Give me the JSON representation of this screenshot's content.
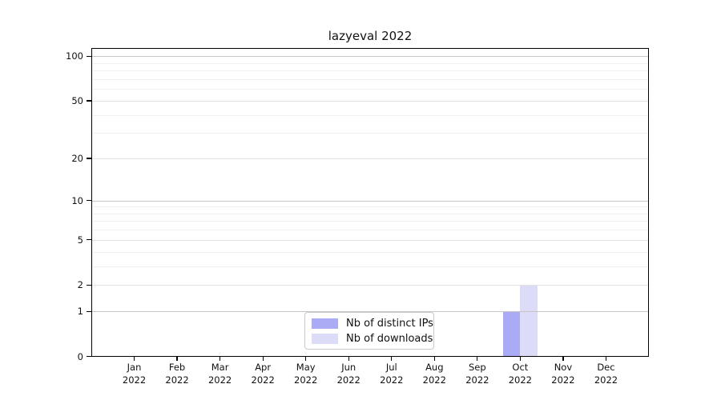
{
  "chart_data": {
    "type": "bar",
    "title": "lazyeval 2022",
    "categories": [
      "Jan 2022",
      "Feb 2022",
      "Mar 2022",
      "Apr 2022",
      "May 2022",
      "Jun 2022",
      "Jul 2022",
      "Aug 2022",
      "Sep 2022",
      "Oct 2022",
      "Nov 2022",
      "Dec 2022"
    ],
    "series": [
      {
        "name": "Nb of distinct IPs",
        "color": "#aaaaf5",
        "values": [
          0,
          0,
          0,
          0,
          0,
          0,
          0,
          0,
          0,
          1,
          0,
          0
        ]
      },
      {
        "name": "Nb of downloads",
        "color": "#dcdcf8",
        "values": [
          0,
          0,
          0,
          0,
          0,
          0,
          0,
          0,
          0,
          2,
          0,
          0
        ]
      }
    ],
    "y_ticks": [
      0,
      1,
      2,
      5,
      10,
      20,
      50,
      100
    ],
    "y_minor_gridlines": [
      3,
      4,
      6,
      7,
      8,
      9,
      30,
      40,
      60,
      70,
      80,
      90
    ],
    "y_scale": "log1p",
    "ylim": [
      0,
      113
    ],
    "grid": true,
    "legend_position": "lower center inside"
  }
}
